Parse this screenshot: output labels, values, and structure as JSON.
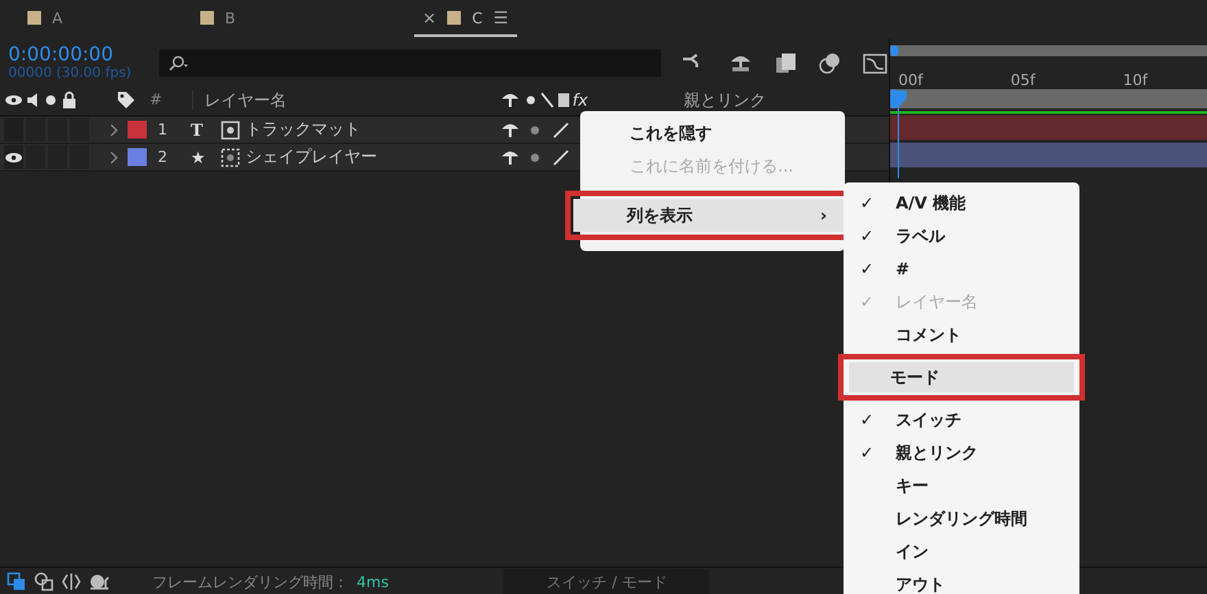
{
  "tabs": [
    {
      "label": "A",
      "selected": false
    },
    {
      "label": "B",
      "selected": false
    },
    {
      "label": "C",
      "selected": true,
      "close": "×",
      "menu": "☰"
    }
  ],
  "timecode": "0:00:00:00",
  "frame_info": "00000 (30.00 fps)",
  "columns": {
    "number": "#",
    "layer_name": "レイヤー名",
    "parent": "親とリンク",
    "fx": "fx"
  },
  "layers": [
    {
      "number": "1",
      "name": "トラックマット",
      "kind": "text",
      "type_glyph": "T",
      "color": "#c8323a",
      "visible": false
    },
    {
      "number": "2",
      "name": "シェイプレイヤー",
      "kind": "shape",
      "type_glyph": "★",
      "color": "#6a7fe0",
      "visible": true
    }
  ],
  "ruler": [
    "00f",
    "05f",
    "10f"
  ],
  "context_menu": [
    {
      "label": "これを隠す",
      "disabled": false,
      "selected": false,
      "emphasized": false
    },
    {
      "label": "これに名前を付ける...",
      "disabled": true,
      "selected": false,
      "emphasized": false
    },
    {
      "label": "列を表示",
      "disabled": false,
      "selected": true,
      "emphasized": true,
      "arrow": "›"
    }
  ],
  "submenu": [
    {
      "label": "A/V 機能",
      "checked": true,
      "disabled": false,
      "selected": false,
      "emphasized": false
    },
    {
      "label": "ラベル",
      "checked": true,
      "disabled": false,
      "selected": false,
      "emphasized": false
    },
    {
      "label": "#",
      "checked": true,
      "disabled": false,
      "selected": false,
      "emphasized": false
    },
    {
      "label": "レイヤー名",
      "checked": true,
      "disabled": true,
      "selected": false,
      "emphasized": false
    },
    {
      "label": "コメント",
      "checked": false,
      "disabled": false,
      "selected": false,
      "emphasized": false
    },
    {
      "label": "モード",
      "checked": false,
      "disabled": false,
      "selected": true,
      "emphasized": true
    },
    {
      "label": "スイッチ",
      "checked": true,
      "disabled": false,
      "selected": false,
      "emphasized": false
    },
    {
      "label": "親とリンク",
      "checked": true,
      "disabled": false,
      "selected": false,
      "emphasized": false
    },
    {
      "label": "キー",
      "checked": false,
      "disabled": false,
      "selected": false,
      "emphasized": false
    },
    {
      "label": "レンダリング時間",
      "checked": false,
      "disabled": false,
      "selected": false,
      "emphasized": false
    },
    {
      "label": "イン",
      "checked": false,
      "disabled": false,
      "selected": false,
      "emphasized": false
    },
    {
      "label": "アウト",
      "checked": false,
      "disabled": false,
      "selected": false,
      "emphasized": false
    }
  ],
  "check_glyph": "✓",
  "status_bar": {
    "label": "フレームレンダリング時間：",
    "value": "4ms",
    "toggle": "スイッチ / モード"
  }
}
